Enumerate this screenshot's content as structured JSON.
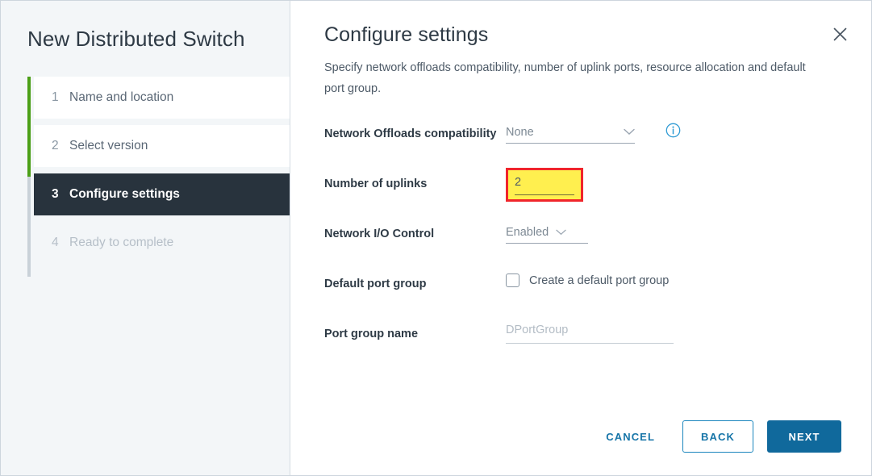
{
  "wizard": {
    "title": "New Distributed Switch",
    "steps": [
      {
        "number": "1",
        "label": "Name and location",
        "state": "complete"
      },
      {
        "number": "2",
        "label": "Select version",
        "state": "complete"
      },
      {
        "number": "3",
        "label": "Configure settings",
        "state": "active"
      },
      {
        "number": "4",
        "label": "Ready to complete",
        "state": "upcoming"
      }
    ]
  },
  "header": {
    "title": "Configure settings",
    "description": "Specify network offloads compatibility, number of uplink ports, resource allocation and default port group.",
    "close_icon": "close-icon"
  },
  "form": {
    "network_offloads": {
      "label": "Network Offloads compatibility",
      "value": "None",
      "chevron_icon": "chevron-down-icon",
      "info_icon": "info-icon"
    },
    "number_of_uplinks": {
      "label": "Number of uplinks",
      "value": "2",
      "highlight_border_color": "#f0252b",
      "highlight_fill_color": "#ffef4f"
    },
    "network_io_control": {
      "label": "Network I/O Control",
      "value": "Enabled",
      "chevron_icon": "chevron-down-icon"
    },
    "default_port_group": {
      "label": "Default port group",
      "checkbox_label": "Create a default port group",
      "checked": false
    },
    "port_group_name": {
      "label": "Port group name",
      "placeholder": "DPortGroup",
      "value": ""
    }
  },
  "footer": {
    "cancel_label": "CANCEL",
    "back_label": "BACK",
    "next_label": "NEXT"
  },
  "colors": {
    "accent_blue": "#10699c",
    "link_blue": "#1775a8",
    "active_step": "#28333d",
    "progress_green": "#4b9f17",
    "sidebar_bg": "#f3f6f8"
  }
}
